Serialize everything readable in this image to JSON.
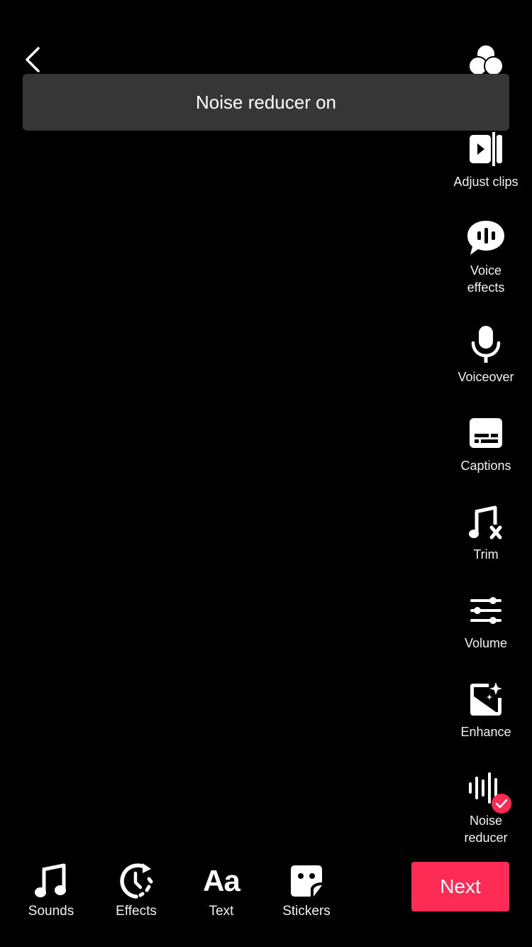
{
  "toast": {
    "message": "Noise reducer on"
  },
  "side_tools": [
    {
      "id": "filters",
      "label": "Filters",
      "icon": "filters-icon"
    },
    {
      "id": "adjust-clips",
      "label": "Adjust clips",
      "icon": "adjust-clips-icon"
    },
    {
      "id": "voice-effects",
      "label_line1": "Voice",
      "label_line2": "effects",
      "icon": "voice-effects-icon"
    },
    {
      "id": "voiceover",
      "label": "Voiceover",
      "icon": "microphone-icon"
    },
    {
      "id": "captions",
      "label": "Captions",
      "icon": "captions-icon"
    },
    {
      "id": "trim",
      "label": "Trim",
      "icon": "trim-music-icon"
    },
    {
      "id": "volume",
      "label": "Volume",
      "icon": "sliders-icon"
    },
    {
      "id": "enhance",
      "label": "Enhance",
      "icon": "enhance-image-icon"
    },
    {
      "id": "noise-reducer",
      "label_line1": "Noise",
      "label_line2": "reducer",
      "icon": "waveform-icon",
      "active": true
    }
  ],
  "bottom_tools": [
    {
      "id": "sounds",
      "label": "Sounds",
      "icon": "music-note-icon"
    },
    {
      "id": "effects",
      "label": "Effects",
      "icon": "effects-clock-icon"
    },
    {
      "id": "text",
      "label": "Text",
      "icon": "text-aa-icon"
    },
    {
      "id": "stickers",
      "label": "Stickers",
      "icon": "sticker-icon"
    }
  ],
  "next_button": {
    "label": "Next"
  },
  "colors": {
    "accent": "#fe2c55",
    "toast_bg": "#363636",
    "background": "#000000"
  }
}
